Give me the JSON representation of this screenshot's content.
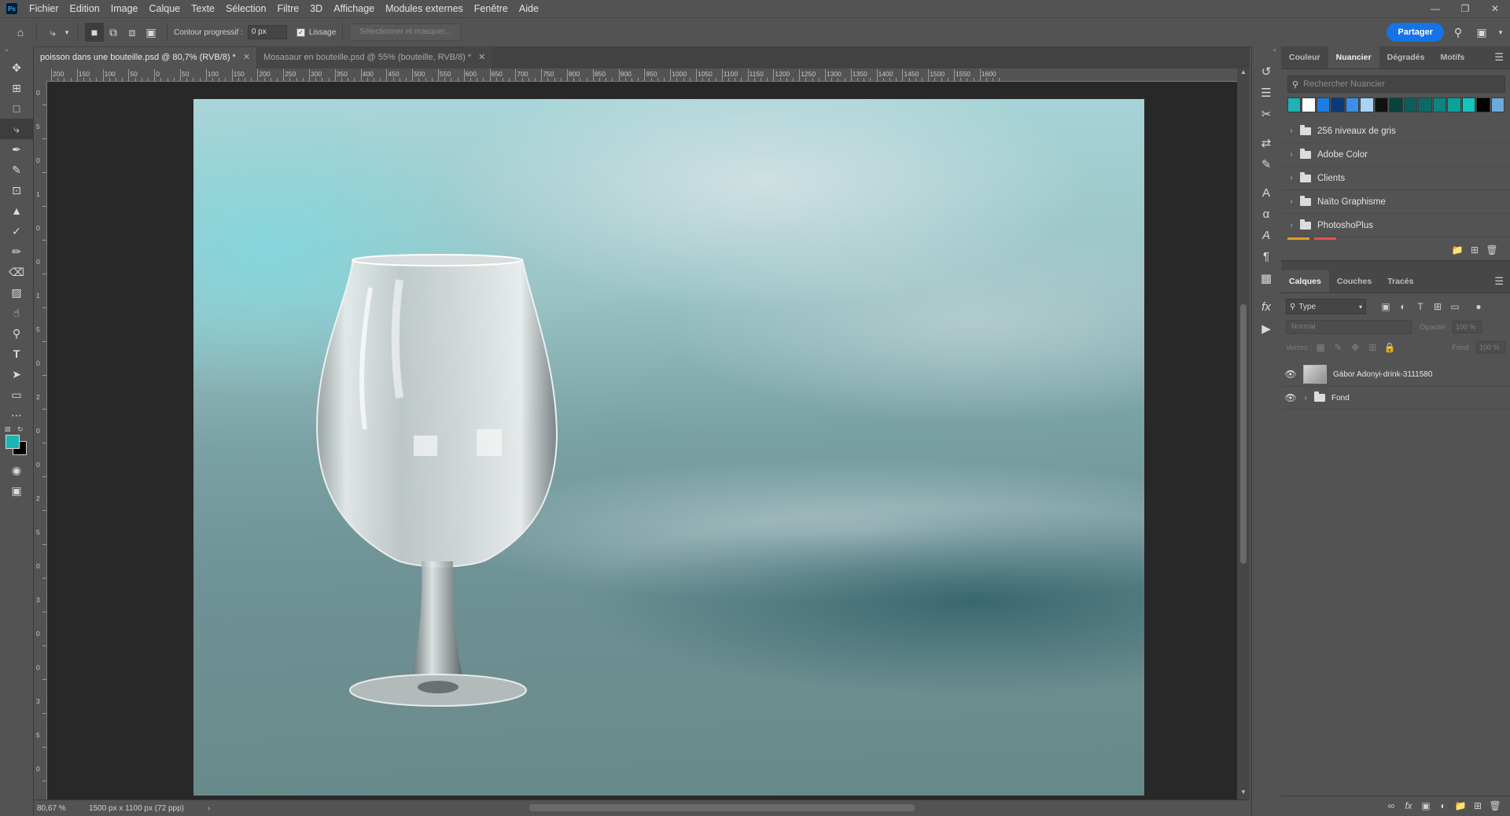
{
  "app": {
    "logo": "Ps"
  },
  "menu": [
    "Fichier",
    "Edition",
    "Image",
    "Calque",
    "Texte",
    "Sélection",
    "Filtre",
    "3D",
    "Affichage",
    "Modules externes",
    "Fenêtre",
    "Aide"
  ],
  "options": {
    "contour_label": "Contour progressif :",
    "contour_value": "0 px",
    "lissage_label": "Lissage",
    "select_mask": "Sélectionner et masquer...",
    "share": "Partager"
  },
  "tabs": [
    {
      "label": "poisson dans une bouteille.psd @ 80,7% (RVB/8) *",
      "active": true
    },
    {
      "label": "Mosasaur en bouteille.psd @ 55% (bouteille, RVB/8) *",
      "active": false
    }
  ],
  "ruler": {
    "h_labels": [
      "200",
      "150",
      "100",
      "50",
      "0",
      "50",
      "100",
      "150",
      "200",
      "250",
      "300",
      "350",
      "400",
      "450",
      "500",
      "550",
      "600",
      "650",
      "700",
      "750",
      "800",
      "850",
      "900",
      "950",
      "1000",
      "1050",
      "1100",
      "1150",
      "1200",
      "1250",
      "1300",
      "1350",
      "1400",
      "1450",
      "1500",
      "1550",
      "1600"
    ],
    "v_labels": [
      "0",
      "5",
      "0",
      "1",
      "0",
      "0",
      "1",
      "5",
      "0",
      "2",
      "0",
      "0",
      "2",
      "5",
      "0",
      "3",
      "0",
      "0",
      "3",
      "5",
      "0"
    ]
  },
  "status": {
    "zoom": "80,67 %",
    "doc_size": "1500 px x 1100 px (72 ppp)"
  },
  "swatches_panel": {
    "tabs": [
      "Couleur",
      "Nuancier",
      "Dégradés",
      "Motifs"
    ],
    "active_tab": "Nuancier",
    "search_placeholder": "Rechercher Nuancier",
    "colors": [
      "#1cb4b4",
      "#ffffff",
      "#1a7fe0",
      "#0b3a7a",
      "#3d8ee8",
      "#a9d4f5",
      "#111111",
      "#08423f",
      "#0c5e5a",
      "#0a6b66",
      "#0c8480",
      "#0aa39c",
      "#15c4bd",
      "#000000",
      "#6aa9dc"
    ],
    "groups": [
      "256 niveaux de gris",
      "Adobe Color",
      "Clients",
      "Naïto Graphisme",
      "PhotoshoPlus"
    ]
  },
  "layers_panel": {
    "tabs": [
      "Calques",
      "Couches",
      "Tracés"
    ],
    "active_tab": "Calques",
    "filter": "Type",
    "blend_mode": "Normal",
    "opacity_label": "Opacité :",
    "opacity_value": "100 %",
    "lock_label": "Verrou :",
    "fill_label": "Fond :",
    "fill_value": "100 %",
    "layers": [
      {
        "name": "Gábor Adonyi-drink-3111580",
        "kind": "image",
        "visible": true
      },
      {
        "name": "Fond",
        "kind": "group",
        "visible": true
      }
    ]
  }
}
